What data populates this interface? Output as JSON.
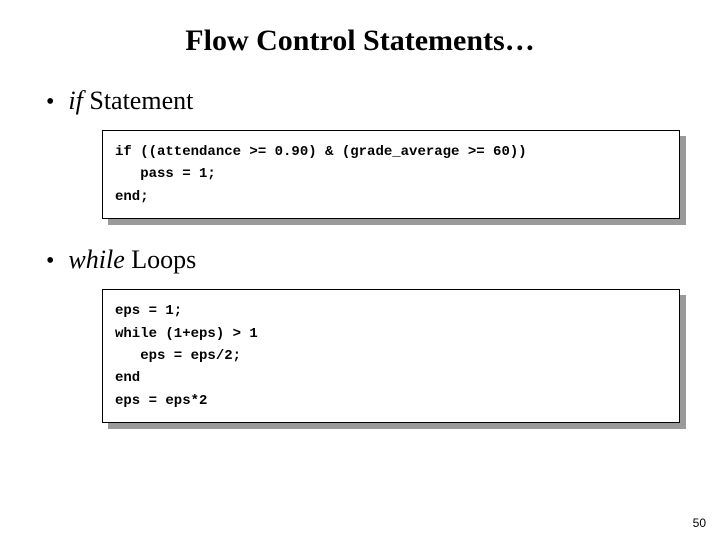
{
  "title": "Flow Control Statements…",
  "bullet_glyph": "•",
  "sections": [
    {
      "label_italic": "if",
      "label_rest": " Statement",
      "code": [
        "if ((attendance >= 0.90) & (grade_average >= 60))",
        "   pass = 1;",
        "end;"
      ]
    },
    {
      "label_italic": "while",
      "label_rest": " Loops",
      "code": [
        "eps = 1;",
        "while (1+eps) > 1",
        "   eps = eps/2;",
        "end",
        "eps = eps*2"
      ]
    }
  ],
  "page_number": "50"
}
